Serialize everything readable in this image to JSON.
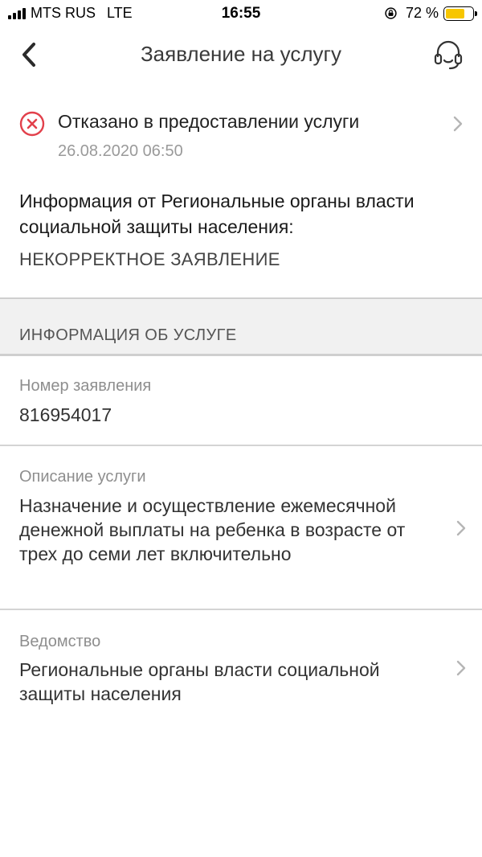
{
  "status_bar": {
    "carrier": "MTS RUS",
    "network": "LTE",
    "time": "16:55",
    "battery": "72 %",
    "battery_level": 0.72
  },
  "nav": {
    "title": "Заявление на услугу"
  },
  "status": {
    "title": "Отказано в предоставлении услуги",
    "date": "26.08.2020 06:50",
    "color": "#e2404b"
  },
  "info": {
    "title": "Информация от Региональные органы власти социальной защиты населения:",
    "value": "НЕКОРРЕКТНОЕ ЗАЯВЛЕНИЕ"
  },
  "section": {
    "title": "ИНФОРМАЦИЯ ОБ УСЛУГЕ"
  },
  "fields": [
    {
      "label": "Номер заявления",
      "value": "816954017"
    },
    {
      "label": "Описание услуги",
      "value": "Назначение и осуществление ежемесячной денежной выплаты на ребенка в возрасте от трех до семи лет включительно"
    },
    {
      "label": "Ведомство",
      "value": "Региональные органы власти социальной защиты населения"
    }
  ]
}
